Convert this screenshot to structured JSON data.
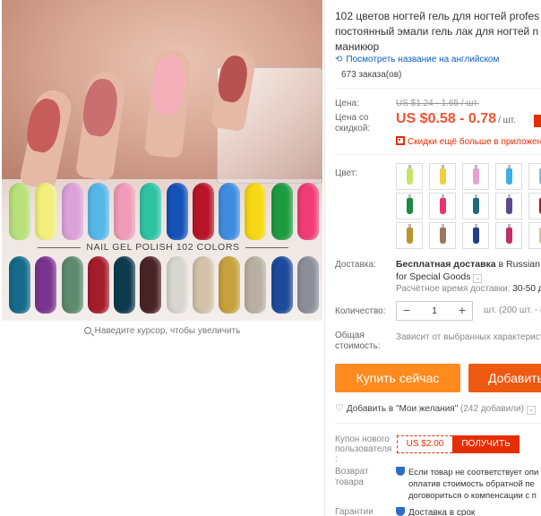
{
  "gallery": {
    "banner_text": "NAIL GEL POLISH 102 COLORS",
    "zoom_hint": "Наведите курсор, чтобы увеличить",
    "row1_colors": [
      "#b9e07a",
      "#f2ef7c",
      "#dca1d8",
      "#55b7e8",
      "#f19bb8",
      "#2fc3a4",
      "#1452b8",
      "#b81429",
      "#3f8ce0",
      "#f6d814",
      "#1e9b3f",
      "#f03c77"
    ],
    "row2_colors": [
      "#166a8a",
      "#7a3590",
      "#5e8a6d",
      "#a51c2b",
      "#0f3b4e",
      "#4a2326",
      "#d8d6d0",
      "#d2c2a9",
      "#c7a23c",
      "#b9b0a0",
      "#1d4a9c",
      "#8c8e99"
    ],
    "hand_nail_colors": [
      "#c65d5a",
      "#c96f70",
      "#f3b0b8",
      "#b6524f"
    ]
  },
  "product": {
    "title_lines": [
      "102 цветов ногтей гель для ногтей profes",
      "постоянный эмали гель лак для ногтей n",
      "маникюр"
    ],
    "translate_link": "Посмотреть название на английском",
    "orders": "673 заказа(ов)"
  },
  "price": {
    "label": "Цена:",
    "old": "US $1.24 - 1.65 / шт.",
    "discount_label_line1": "Цена со",
    "discount_label_line2": "скидкой:",
    "new": "US $0.58 - 0.78",
    "unit": "/ шт.",
    "app_promo": "Скидки ещё больше в приложен"
  },
  "color": {
    "label": "Цвет:",
    "swatches": [
      "#c9e36a",
      "#f0d040",
      "#e8a2cf",
      "#3aaee0",
      "#6fc4e6",
      "#c58ad0",
      "#1e8a44",
      "#e8336b",
      "#1f6b7d",
      "#5a4a8a",
      "#a51c2b",
      "#8a5aa8",
      "#b9952c",
      "#9a7a5a",
      "#1f3f8c",
      "#c0306a",
      "#d2c2a9",
      "#7a2c8a"
    ]
  },
  "shipping": {
    "label": "Доставка:",
    "title_bold": "Бесплатная доставка",
    "title_rest": " в Russian Fe",
    "line2": "for Special Goods",
    "time_label": "Расчётное время доставки:",
    "time_value": " 30-50 д"
  },
  "quantity": {
    "label": "Количество:",
    "value": "1",
    "minus": "−",
    "plus": "+",
    "note": "шт. (200 шт. - всего д"
  },
  "total": {
    "label_line1": "Общая",
    "label_line2": "стоимость:",
    "note": "Зависит от выбранных характерист"
  },
  "actions": {
    "buy_now": "Купить сейчас",
    "add_cart": "Добавить",
    "wishlist": "Добавить в \"Мои желания\"",
    "wishlist_count": "(242 добавили)"
  },
  "coupon": {
    "label": "Купон нового пользователя :",
    "value": "US $2.00",
    "get": "ПОЛУЧИТЬ"
  },
  "returns": {
    "label": "Возврат товара",
    "lines": [
      "Если товар не соответствует опи",
      "оплатив стоимость обратной пе",
      "договориться о компенсации с п"
    ]
  },
  "guarantee": {
    "label": "Гарантии",
    "text": "Доставка в срок"
  },
  "colors": {
    "accent_orange": "#ff8a1d",
    "accent_red": "#e62e04",
    "price_red": "#f0542d",
    "link_blue": "#0a5fbf"
  }
}
